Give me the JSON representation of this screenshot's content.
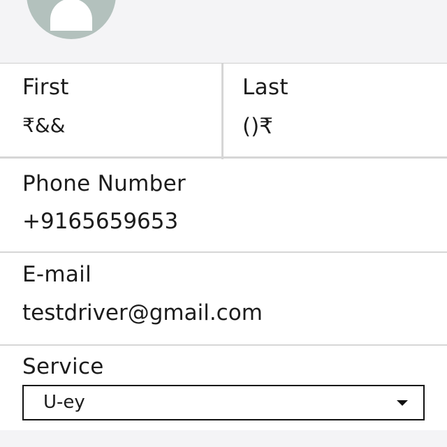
{
  "profile": {
    "avatar_icon": "user-avatar-icon",
    "avatar_color": "#b3c1bd"
  },
  "form": {
    "first_name": {
      "label": "First",
      "value": "₹&&"
    },
    "last_name": {
      "label": "Last",
      "value": "()₹"
    },
    "phone": {
      "label": "Phone Number",
      "value": "+9165659653"
    },
    "email": {
      "label": "E-mail",
      "value": "testdriver@gmail.com"
    },
    "service": {
      "label": "Service",
      "selected": "U-ey",
      "caret_icon": "caret-down-icon"
    }
  }
}
